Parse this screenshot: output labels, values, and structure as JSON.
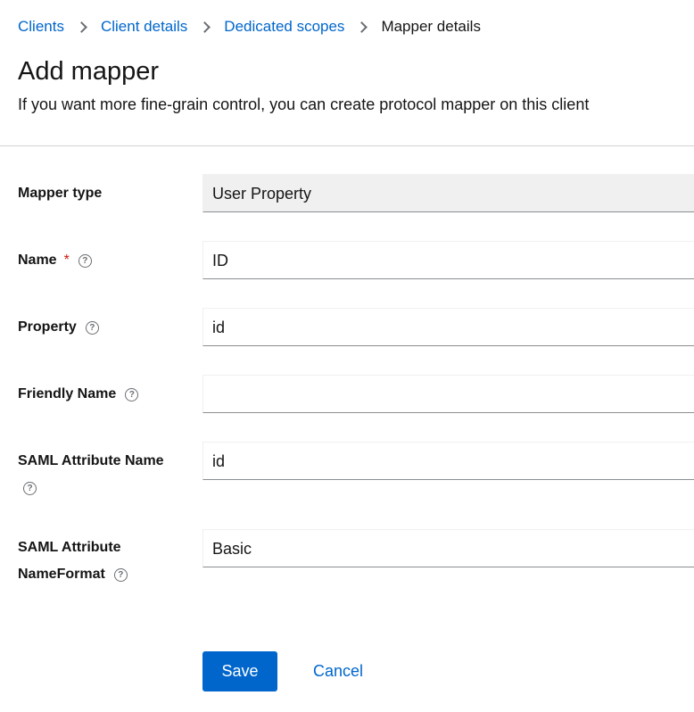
{
  "breadcrumb": {
    "items": [
      {
        "label": "Clients"
      },
      {
        "label": "Client details"
      },
      {
        "label": "Dedicated scopes"
      }
    ],
    "current": "Mapper details"
  },
  "header": {
    "title": "Add mapper",
    "subtitle": "If you want more fine-grain control, you can create protocol mapper on this client"
  },
  "form": {
    "mapper_type": {
      "label": "Mapper type",
      "value": "User Property"
    },
    "name": {
      "label": "Name",
      "required_mark": "*",
      "value": "ID"
    },
    "property": {
      "label": "Property",
      "value": "id"
    },
    "friendly_name": {
      "label": "Friendly Name",
      "value": ""
    },
    "saml_attribute_name": {
      "label": "SAML Attribute Name",
      "value": "id"
    },
    "saml_attribute_nameformat": {
      "label_line1": "SAML Attribute",
      "label_line2": "NameFormat",
      "value": "Basic"
    },
    "help_glyph": "?"
  },
  "actions": {
    "save": "Save",
    "cancel": "Cancel"
  }
}
